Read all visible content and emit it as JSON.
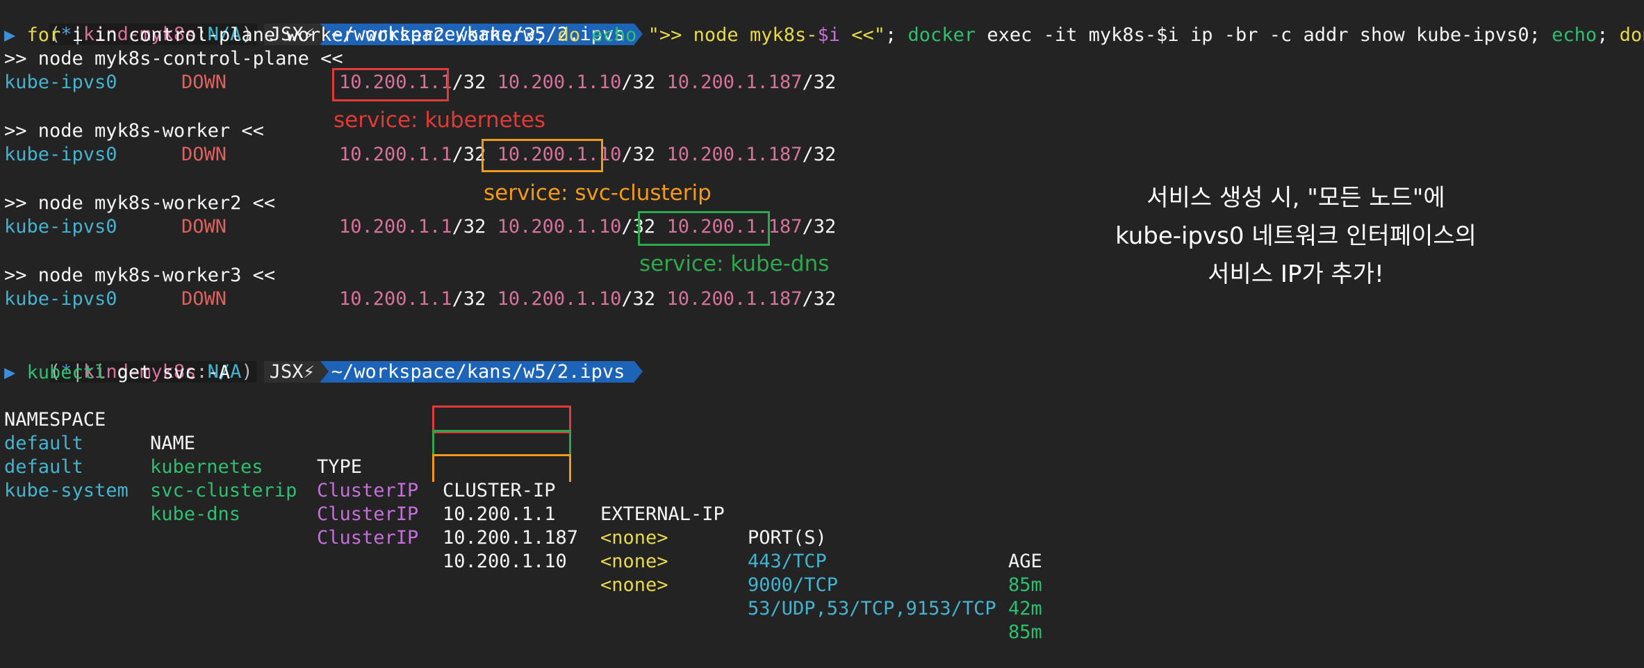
{
  "prompt": {
    "ctx_open": "(",
    "ctx_star": "*",
    "ctx_bar": "|",
    "ctx_cluster": "kind-myk8s",
    "ctx_colon": ":",
    "ctx_ns": "N/A",
    "ctx_close": ")",
    "jsx": "JSX⚡",
    "path": "~/workspace/kans/w5/2.ipvs"
  },
  "command1": {
    "arrow": "▶",
    "for": "for",
    "rest1": " i in control-plane worker worker2 worker3; ",
    "do": "do",
    "sp1": " ",
    "echo1": "echo",
    "sp2": " ",
    "str1": "\">> node myk8s-",
    "var": "$i",
    "str2": " <<\"",
    "semi1": "; ",
    "docker": "docker",
    "rest2": " exec -it myk8s-$i ip -br -c addr show kube-ipvs0; ",
    "echo2": "echo",
    "semi2": "; ",
    "done": "done"
  },
  "nodes": [
    {
      "header": ">> node myk8s-control-plane <<",
      "iface": "kube-ipvs0",
      "state": "DOWN",
      "ips": [
        "10.200.1.1",
        "10.200.1.10",
        "10.200.1.187"
      ],
      "mask": "/32"
    },
    {
      "header": ">> node myk8s-worker <<",
      "iface": "kube-ipvs0",
      "state": "DOWN",
      "ips": [
        "10.200.1.1",
        "10.200.1.10",
        "10.200.1.187"
      ],
      "mask": "/32"
    },
    {
      "header": ">> node myk8s-worker2 <<",
      "iface": "kube-ipvs0",
      "state": "DOWN",
      "ips": [
        "10.200.1.1",
        "10.200.1.10",
        "10.200.1.187"
      ],
      "mask": "/32"
    },
    {
      "header": ">> node myk8s-worker3 <<",
      "iface": "kube-ipvs0",
      "state": "DOWN",
      "ips": [
        "10.200.1.1",
        "10.200.1.10",
        "10.200.1.187"
      ],
      "mask": "/32"
    }
  ],
  "annotations": {
    "kubernetes": "service: kubernetes",
    "clusterip": "service: svc-clusterip",
    "kubedns": "service: kube-dns"
  },
  "note": {
    "line1": "서비스 생성 시, \"모든 노드\"에",
    "line2": "kube-ipvs0 네트워크 인터페이스의",
    "line3": "서비스 IP가 추가!"
  },
  "command2": {
    "arrow": "▶",
    "kubectl": "kubectl",
    "args": " get svc -A"
  },
  "svc_table": {
    "headers": [
      "NAMESPACE",
      "NAME",
      "TYPE",
      "CLUSTER-IP",
      "EXTERNAL-IP",
      "PORT(S)",
      "AGE"
    ],
    "rows": [
      [
        "default",
        "kubernetes",
        "ClusterIP",
        "10.200.1.1",
        "<none>",
        "443/TCP",
        "85m"
      ],
      [
        "default",
        "svc-clusterip",
        "ClusterIP",
        "10.200.1.187",
        "<none>",
        "9000/TCP",
        "42m"
      ],
      [
        "kube-system",
        "kube-dns",
        "ClusterIP",
        "10.200.1.10",
        "<none>",
        "53/UDP,53/TCP,9153/TCP",
        "85m"
      ]
    ]
  },
  "colors": {
    "background": "#232323",
    "highlight_red": "#e23a36",
    "highlight_orange": "#f39a1b",
    "highlight_green": "#2fa84d",
    "path_segment": "#1d63b8"
  }
}
